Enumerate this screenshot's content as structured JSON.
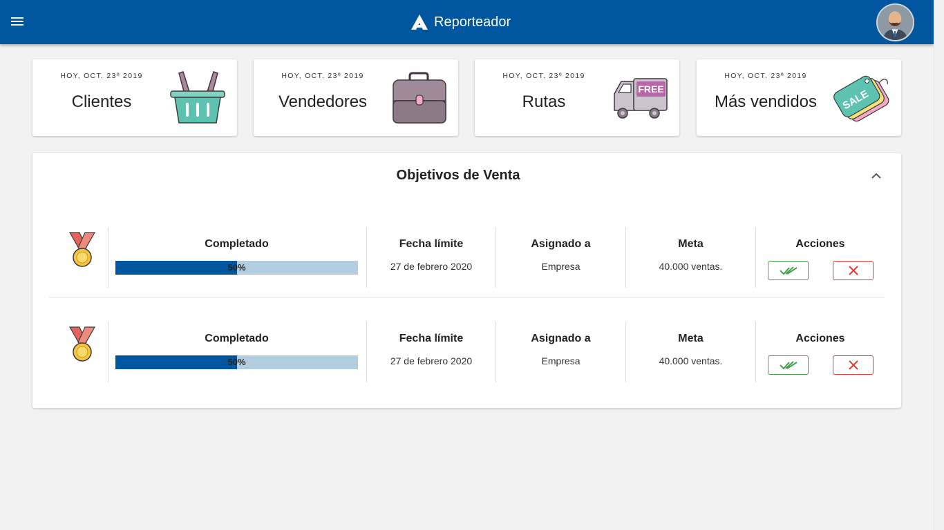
{
  "app": {
    "title": "Reporteador",
    "brand_color": "#00579f",
    "icons": {
      "menu": "menu-icon",
      "logo": "logo-icon",
      "avatar": "avatar-icon",
      "collapse": "chevron-up-icon",
      "approve": "double-check-icon",
      "reject": "close-icon"
    }
  },
  "cards": [
    {
      "date": "HOY, OCT. 23º 2019",
      "title": "Clientes",
      "icon": "basket-icon"
    },
    {
      "date": "HOY, OCT. 23º 2019",
      "title": "Vendedores",
      "icon": "briefcase-icon"
    },
    {
      "date": "HOY, OCT. 23º 2019",
      "title": "Rutas",
      "icon": "delivery-van-icon",
      "badge": "FREE"
    },
    {
      "date": "HOY, OCT. 23º 2019",
      "title": "Más vendidos",
      "icon": "sale-tag-icon",
      "badge": "SALE"
    }
  ],
  "objectives": {
    "title": "Objetivos de Venta",
    "headers": {
      "completed": "Completado",
      "deadline": "Fecha límite",
      "assigned": "Asignado a",
      "goal": "Meta",
      "actions": "Acciones"
    },
    "rows": [
      {
        "progress": 0.5,
        "progress_text": "50%",
        "deadline": "27 de febrero 2020",
        "assigned": "Empresa",
        "goal": "40.000 ventas.",
        "icon": "medal-icon"
      },
      {
        "progress": 0.5,
        "progress_text": "50%",
        "deadline": "27 de febrero 2020",
        "assigned": "Empresa",
        "goal": "40.000 ventas.",
        "icon": "medal-icon"
      }
    ]
  }
}
